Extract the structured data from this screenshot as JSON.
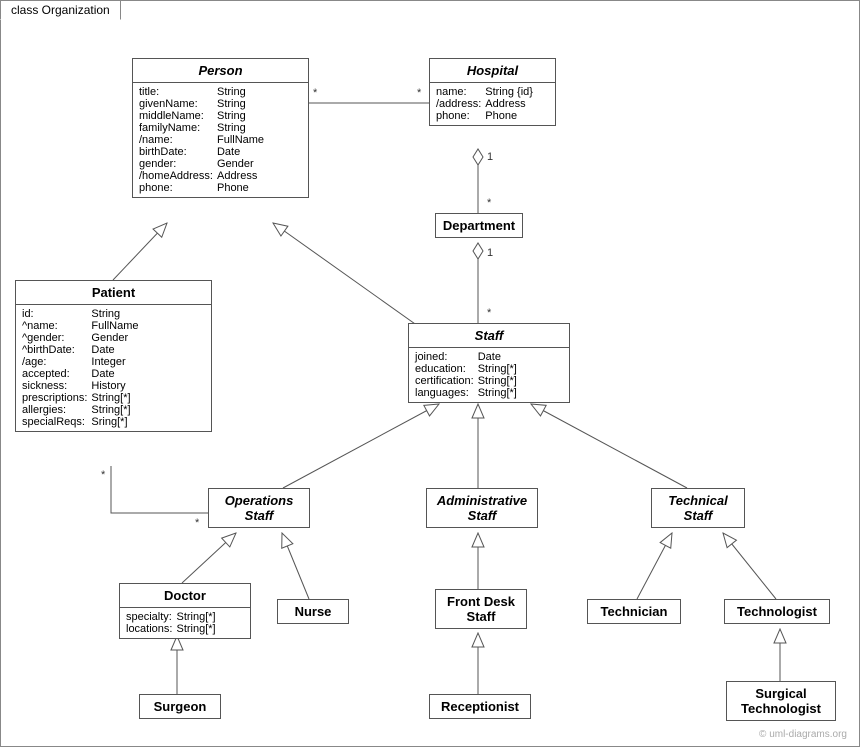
{
  "frame": {
    "title": "class Organization"
  },
  "classes": {
    "person": {
      "name": "Person",
      "attrs": [
        [
          "title:",
          "String"
        ],
        [
          "givenName:",
          "String"
        ],
        [
          "middleName:",
          "String"
        ],
        [
          "familyName:",
          "String"
        ],
        [
          "/name:",
          "FullName"
        ],
        [
          "birthDate:",
          "Date"
        ],
        [
          "gender:",
          "Gender"
        ],
        [
          "/homeAddress:",
          "Address"
        ],
        [
          "phone:",
          "Phone"
        ]
      ]
    },
    "hospital": {
      "name": "Hospital",
      "attrs": [
        [
          "name:",
          "String {id}"
        ],
        [
          "/address:",
          "Address"
        ],
        [
          "phone:",
          "Phone"
        ]
      ]
    },
    "department": {
      "name": "Department"
    },
    "patient": {
      "name": "Patient",
      "attrs": [
        [
          "id:",
          "String"
        ],
        [
          "^name:",
          "FullName"
        ],
        [
          "^gender:",
          "Gender"
        ],
        [
          "^birthDate:",
          "Date"
        ],
        [
          "/age:",
          "Integer"
        ],
        [
          "accepted:",
          "Date"
        ],
        [
          "sickness:",
          "History"
        ],
        [
          "prescriptions:",
          "String[*]"
        ],
        [
          "allergies:",
          "String[*]"
        ],
        [
          "specialReqs:",
          "Sring[*]"
        ]
      ]
    },
    "staff": {
      "name": "Staff",
      "attrs": [
        [
          "joined:",
          "Date"
        ],
        [
          "education:",
          "String[*]"
        ],
        [
          "certification:",
          "String[*]"
        ],
        [
          "languages:",
          "String[*]"
        ]
      ]
    },
    "opsStaff": {
      "name": "Operations",
      "sub": "Staff"
    },
    "adminStaff": {
      "name": "Administrative",
      "sub": "Staff"
    },
    "techStaff": {
      "name": "Technical",
      "sub": "Staff"
    },
    "doctor": {
      "name": "Doctor",
      "attrs": [
        [
          "specialty:",
          "String[*]"
        ],
        [
          "locations:",
          "String[*]"
        ]
      ]
    },
    "nurse": {
      "name": "Nurse"
    },
    "frontDesk": {
      "name": "Front Desk",
      "sub": "Staff"
    },
    "technician": {
      "name": "Technician"
    },
    "technologist": {
      "name": "Technologist"
    },
    "surgeon": {
      "name": "Surgeon"
    },
    "receptionist": {
      "name": "Receptionist"
    },
    "surgTech": {
      "name": "Surgical",
      "sub": "Technologist"
    }
  },
  "mult": {
    "personHospL": "*",
    "personHospR": "*",
    "hospDeptT": "1",
    "hospDeptB": "*",
    "deptStaffT": "1",
    "deptStaffB": "*",
    "patientOpsL": "*",
    "patientOpsR": "*"
  },
  "copyright": "© uml-diagrams.org"
}
